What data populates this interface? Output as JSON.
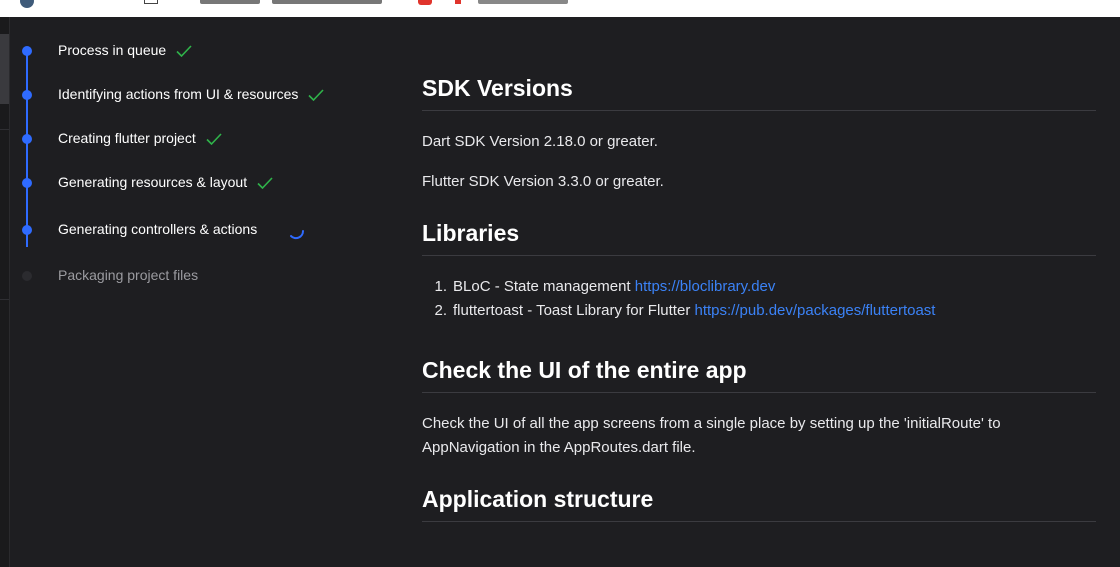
{
  "steps": [
    {
      "label": "Process in queue",
      "status": "done"
    },
    {
      "label": "Identifying actions from UI & resources",
      "status": "done"
    },
    {
      "label": "Creating flutter project",
      "status": "done"
    },
    {
      "label": "Generating resources & layout",
      "status": "done"
    },
    {
      "label": "Generating controllers & actions",
      "status": "in-progress"
    },
    {
      "label": "Packaging project files",
      "status": "pending"
    }
  ],
  "sdk": {
    "heading": "SDK Versions",
    "dart": "Dart SDK Version 2.18.0 or greater.",
    "flutter": "Flutter SDK Version 3.3.0 or greater."
  },
  "libraries": {
    "heading": "Libraries",
    "items": [
      {
        "num": "1.",
        "text": "BLoC - State management",
        "link": "https://bloclibrary.dev"
      },
      {
        "num": "2.",
        "text": "fluttertoast - Toast Library for Flutter",
        "link": "https://pub.dev/packages/fluttertoast"
      }
    ]
  },
  "check_ui": {
    "heading": "Check the UI of the entire app",
    "text": "Check the UI of all the app screens from a single place by setting up the 'initialRoute' to AppNavigation in the AppRoutes.dart file."
  },
  "structure": {
    "heading": "Application structure"
  },
  "colors": {
    "accent": "#2f6bff",
    "check": "#2fb34a",
    "link": "#3b82f6",
    "background": "#1e1e21"
  },
  "icons": {
    "done": "checkmark-icon",
    "in_progress": "spinner-icon"
  }
}
